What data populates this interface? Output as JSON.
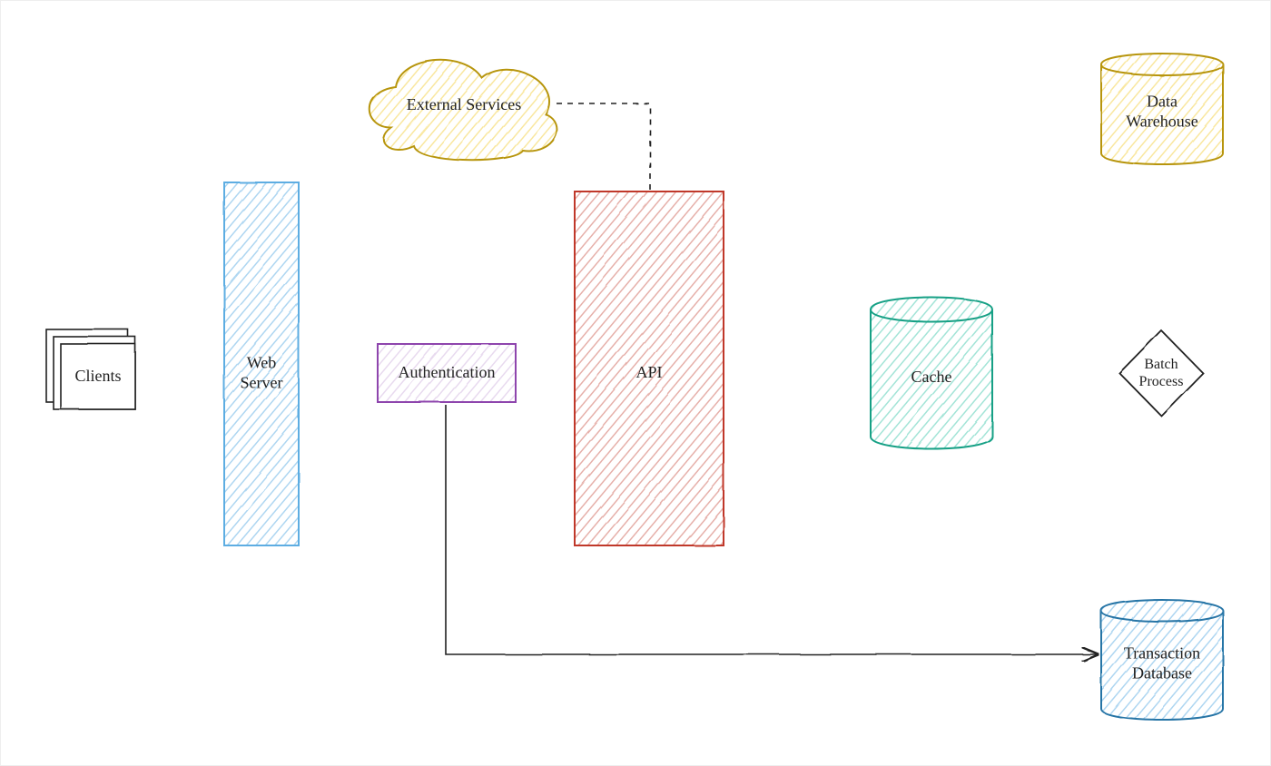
{
  "nodes": {
    "clients": {
      "label": "Clients",
      "shape": "stack",
      "stroke": "#333",
      "fill": "#fff"
    },
    "web_server": {
      "label": "Web\nServer",
      "shape": "rect",
      "stroke": "#5dade2",
      "fill": "#d6eaf8"
    },
    "authentication": {
      "label": "Authentication",
      "shape": "rect",
      "stroke": "#8e44ad",
      "fill": "#ebdef0"
    },
    "api": {
      "label": "API",
      "shape": "rect",
      "stroke": "#c0392b",
      "fill": "#f5b7b1"
    },
    "cache": {
      "label": "Cache",
      "shape": "cylinder",
      "stroke": "#16a085",
      "fill": "#a3e4d7"
    },
    "external_services": {
      "label": "External Services",
      "shape": "cloud",
      "stroke": "#b7950b",
      "fill": "#f9e79f"
    },
    "transaction_db": {
      "label": "Transaction\nDatabase",
      "shape": "cylinder",
      "stroke": "#2874a6",
      "fill": "#aed6f1"
    },
    "batch_process": {
      "label": "Batch\nProcess",
      "shape": "diamond",
      "stroke": "#333",
      "fill": "#fff"
    },
    "data_warehouse": {
      "label": "Data\nWarehouse",
      "shape": "cylinder",
      "stroke": "#b7950b",
      "fill": "#f9e79f"
    }
  },
  "edges": [
    {
      "from": "clients",
      "to": "web_server",
      "style": "arrow"
    },
    {
      "from": "web_server",
      "to": "authentication",
      "style": "arrow"
    },
    {
      "from": "authentication",
      "to": "api",
      "style": "arrow"
    },
    {
      "from": "api",
      "to": "cache",
      "style": "arrow"
    },
    {
      "from": "authentication",
      "to": "external_services",
      "style": "dashed"
    },
    {
      "from": "api",
      "to": "external_services",
      "style": "dashed"
    },
    {
      "from": "authentication",
      "to": "transaction_db",
      "style": "poly-arrow"
    },
    {
      "from": "cache",
      "to": "transaction_db",
      "style": "line"
    },
    {
      "from": "transaction_db",
      "to": "batch_process",
      "style": "arrow"
    },
    {
      "from": "batch_process",
      "to": "data_warehouse",
      "style": "arrow"
    }
  ],
  "colors": {
    "black": "#222"
  }
}
